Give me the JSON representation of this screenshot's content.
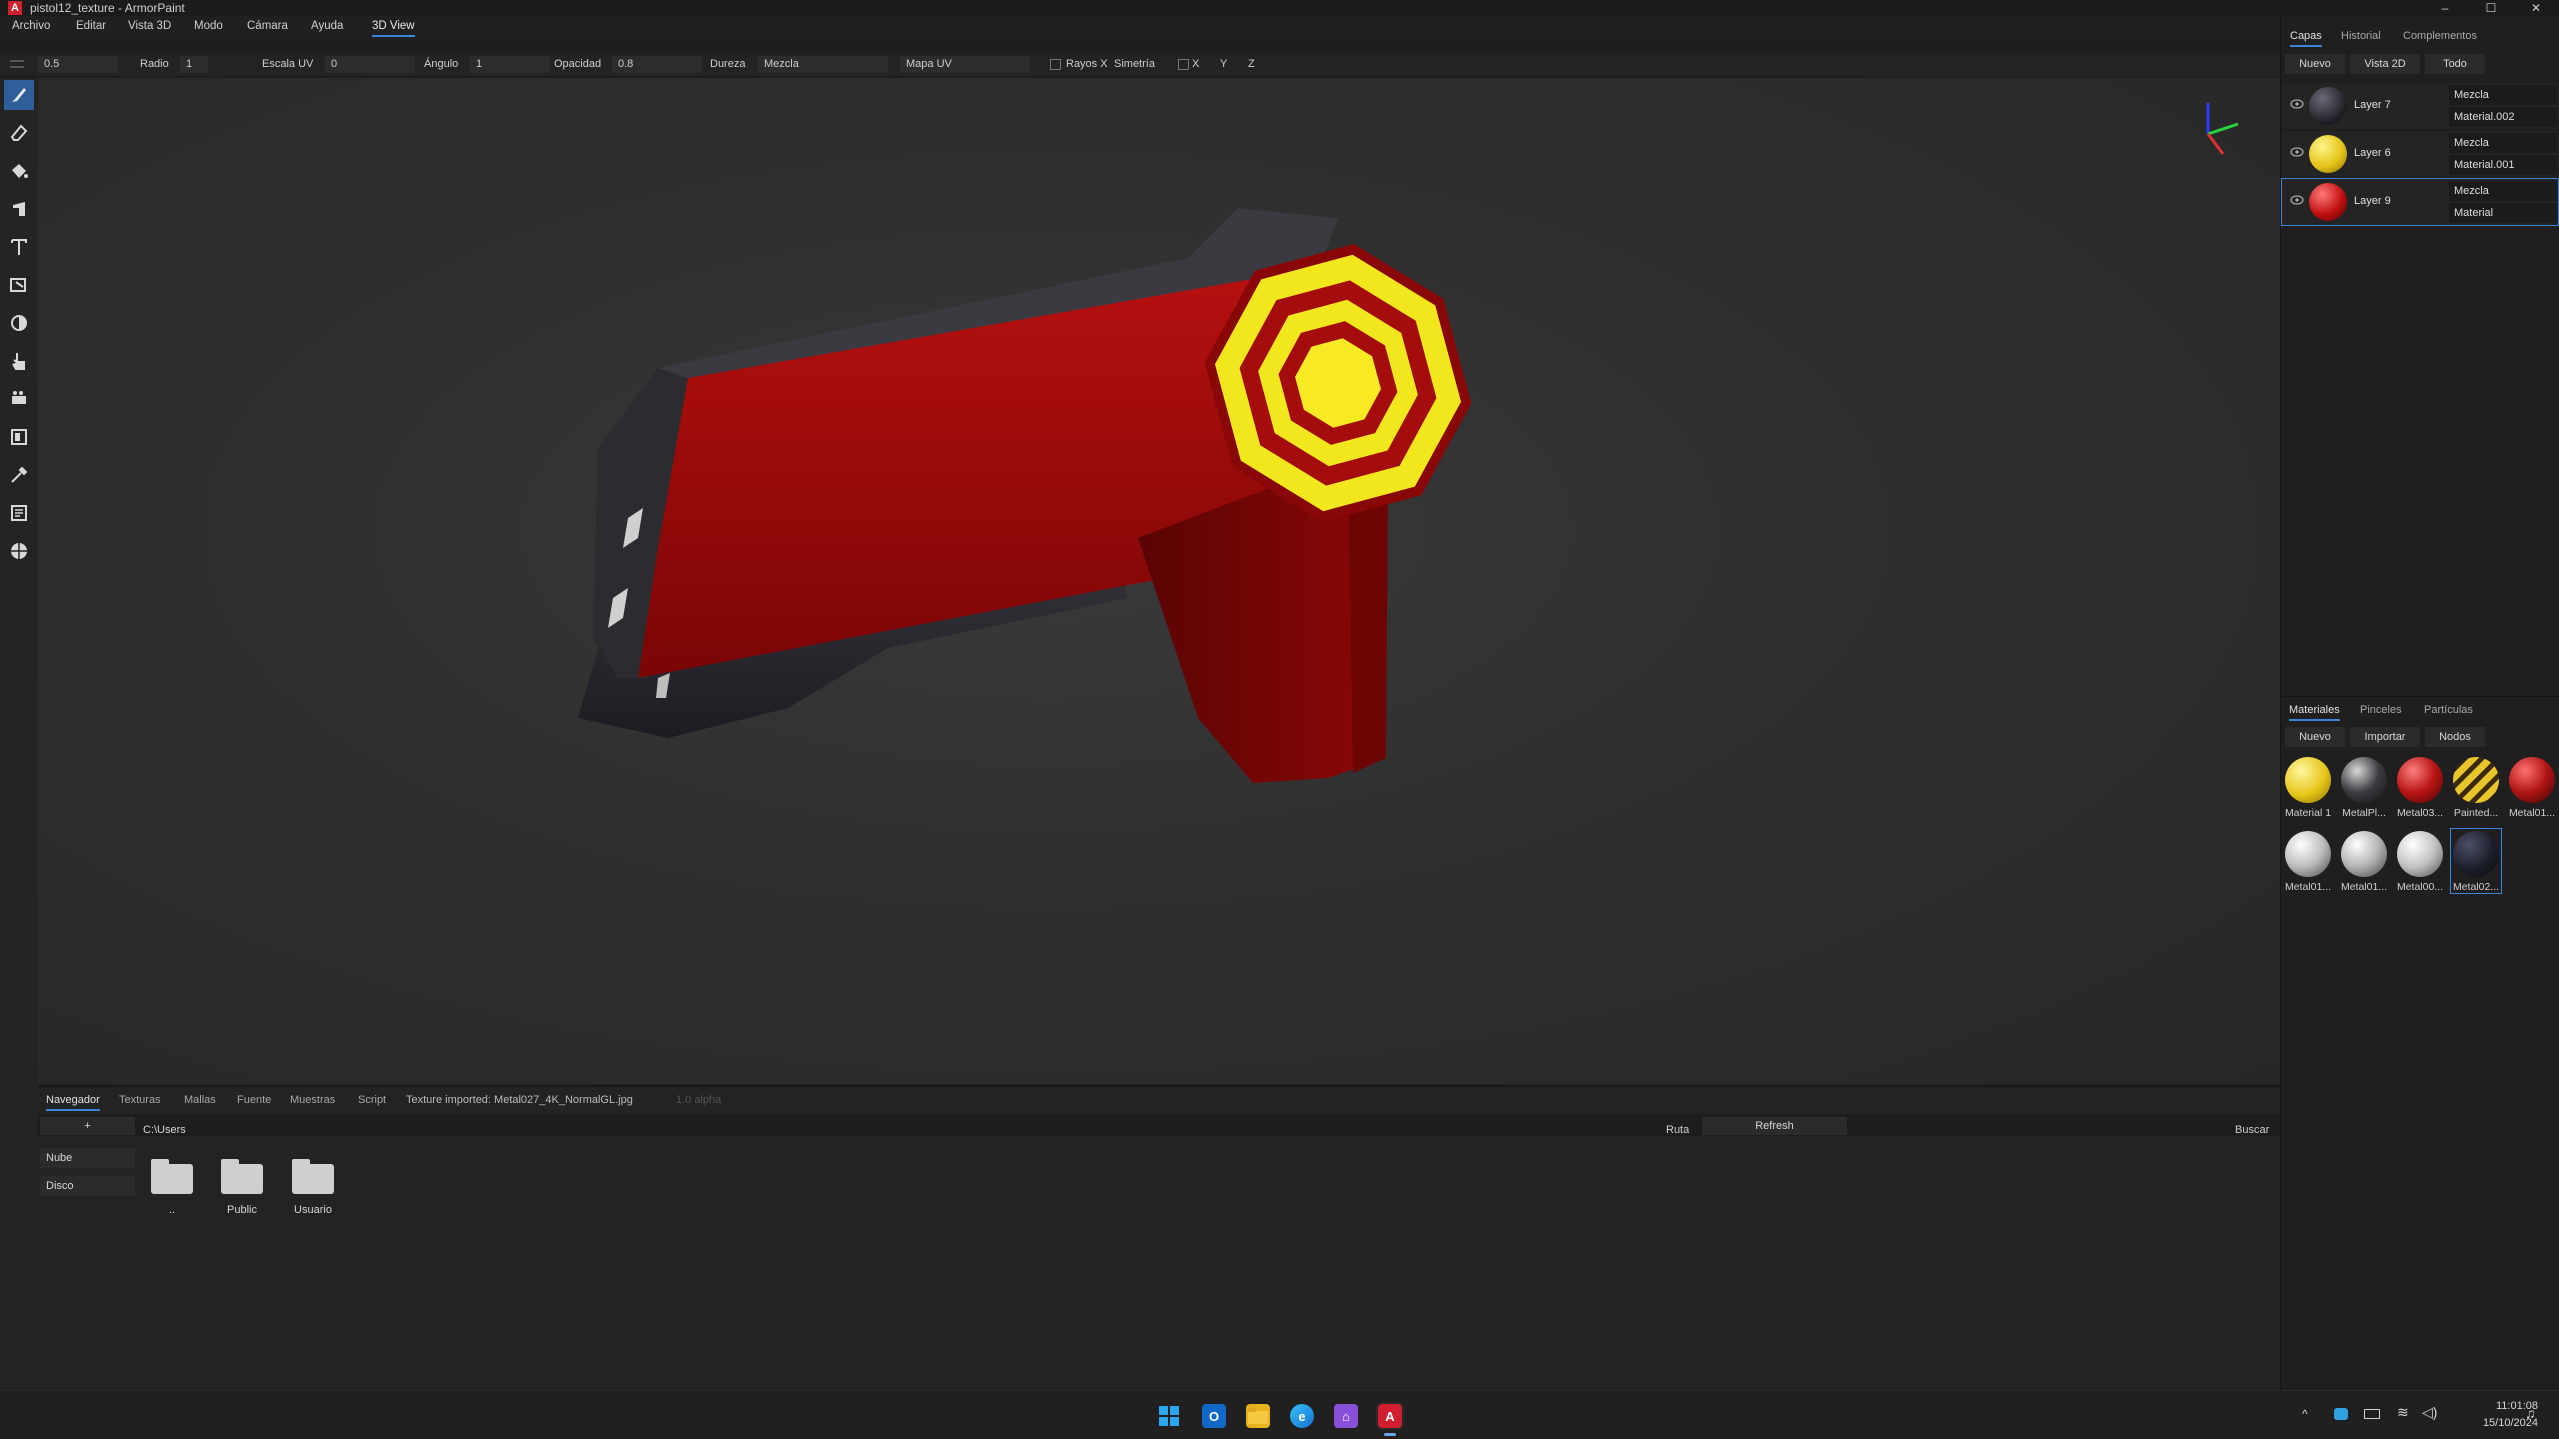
{
  "window": {
    "title": "pistol12_texture - ArmorPaint",
    "app_icon_letter": "A",
    "controls": [
      "–",
      "☐",
      "✕"
    ]
  },
  "menu": {
    "items": [
      "Archivo",
      "Editar",
      "Vista 3D",
      "Modo",
      "Cámara",
      "Ayuda",
      "3D View"
    ],
    "active": "3D View"
  },
  "tool_options": {
    "value_0": "0.5",
    "radio_label": "Radio",
    "radio_value": "1",
    "escala_label": "Escala UV",
    "escala_value": "0",
    "angulo_label": "Ángulo",
    "angulo_value": "1",
    "opacidad_label": "Opacidad",
    "opacidad_value": "0.8",
    "dureza_label": "Dureza",
    "dureza_value": "Mezcla",
    "mapa_value": "Mapa UV",
    "rayos_label": "Rayos X",
    "simetria_label": "Simetría",
    "x": "X",
    "y": "Y",
    "z": "Z"
  },
  "left_tools": [
    "brush-icon",
    "eraser-icon",
    "fill-icon",
    "decal-icon",
    "text-icon",
    "clone-icon",
    "blur-icon",
    "smudge-icon",
    "particle-icon",
    "bake-icon",
    "picker-icon",
    "material-icon",
    "gizmo-icon"
  ],
  "right_panel": {
    "tabs": [
      "Capas",
      "Historial",
      "Complementos"
    ],
    "active_tab": "Capas",
    "buttons": [
      "Nuevo",
      "Vista 2D",
      "Todo"
    ],
    "layers": [
      {
        "name": "Layer 7",
        "blend": "Mezcla",
        "material": "Material.002",
        "ball_color": "#2a2a33",
        "selected": false
      },
      {
        "name": "Layer 6",
        "blend": "Mezcla",
        "material": "Material.001",
        "ball_color": "#e4c51a",
        "selected": false
      },
      {
        "name": "Layer 9",
        "blend": "Mezcla",
        "material": "Material",
        "ball_color": "#c01010",
        "selected": true
      }
    ],
    "materials_tabs": [
      "Materiales",
      "Pinceles",
      "Partículas"
    ],
    "materials_active_tab": "Materiales",
    "materials_buttons": [
      "Nuevo",
      "Importar",
      "Nodos"
    ],
    "materials": [
      {
        "name": "Material 1",
        "color": "#e6c519"
      },
      {
        "name": "MetalPl...",
        "color": "#3b3b40"
      },
      {
        "name": "Metal03...",
        "color": "#b81414"
      },
      {
        "name": "Painted...",
        "color": "#c29a20"
      },
      {
        "name": "Metal01...",
        "color": "#b01515"
      },
      {
        "name": "Metal01...",
        "color": "#bdbdbd"
      },
      {
        "name": "Metal01...",
        "color": "#b3b3b3"
      },
      {
        "name": "Metal00...",
        "color": "#c2c2c2"
      },
      {
        "name": "Metal02...",
        "color": "#1c1f2a"
      }
    ]
  },
  "bottom": {
    "tabs": [
      "Navegador",
      "Texturas",
      "Mallas",
      "Fuente",
      "Muestras",
      "Script"
    ],
    "active_tab": "Navegador",
    "status": "Texture imported: Metal027_4K_NormalGL.jpg",
    "version": "1.0 alpha",
    "add_button": "+",
    "path": "C:\\Users",
    "ruta_label": "Ruta",
    "refresh_label": "Refresh",
    "buscar_label": "Buscar",
    "side_items": [
      "Nube",
      "Disco"
    ],
    "folders": [
      "..",
      "Public",
      "Usuario"
    ]
  },
  "taskbar": {
    "time": "11:01:08",
    "date": "15/10/2024"
  },
  "colors": {
    "accent": "#3b84d6",
    "gun_red": "#a50c0c",
    "gun_yellow": "#f2e61c"
  }
}
